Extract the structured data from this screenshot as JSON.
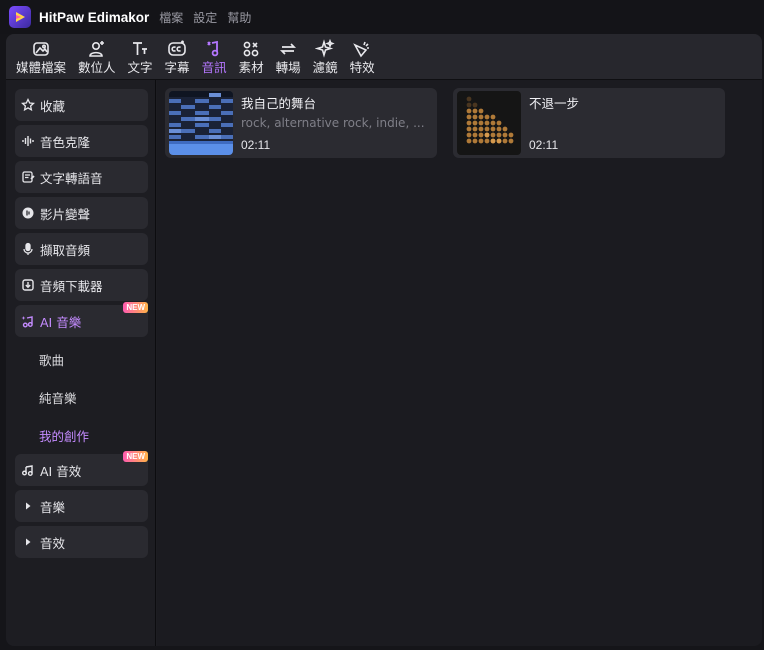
{
  "app": {
    "title": "HitPaw Edimakor",
    "menu": [
      "檔案",
      "設定",
      "幫助"
    ]
  },
  "toolbar": {
    "items": [
      {
        "label": "媒體檔案",
        "icon": "media-icon"
      },
      {
        "label": "數位人",
        "icon": "avatar-add-icon"
      },
      {
        "label": "文字",
        "icon": "text-icon"
      },
      {
        "label": "字幕",
        "icon": "subtitle-icon"
      },
      {
        "label": "音訊",
        "icon": "audio-icon",
        "active": true
      },
      {
        "label": "素材",
        "icon": "assets-icon"
      },
      {
        "label": "轉場",
        "icon": "transition-icon"
      },
      {
        "label": "濾鏡",
        "icon": "filter-icon"
      },
      {
        "label": "特效",
        "icon": "effects-icon"
      }
    ],
    "active_color": "#b577ff"
  },
  "sidebar": {
    "items": [
      {
        "label": "收藏",
        "icon": "star-icon"
      },
      {
        "label": "音色克隆",
        "icon": "waveform-icon"
      },
      {
        "label": "文字轉語音",
        "icon": "text-to-speech-icon"
      },
      {
        "label": "影片變聲",
        "icon": "voice-changer-icon"
      },
      {
        "label": "擷取音頻",
        "icon": "microphone-icon"
      },
      {
        "label": "音頻下載器",
        "icon": "download-icon"
      },
      {
        "label": "AI 音樂",
        "icon": "ai-music-icon",
        "badge": "NEW",
        "active": true
      },
      {
        "label": "AI 音效",
        "icon": "ai-sfx-icon",
        "badge": "NEW"
      },
      {
        "label": "音樂",
        "icon": "caret-right-icon"
      },
      {
        "label": "音效",
        "icon": "caret-right-icon"
      }
    ],
    "sub_items": [
      {
        "label": "歌曲"
      },
      {
        "label": "純音樂"
      },
      {
        "label": "我的創作",
        "active": true
      }
    ]
  },
  "tracks": [
    {
      "title": "我自己的舞台",
      "tags": "rock, alternative rock, indie, ...",
      "duration": "02:11"
    },
    {
      "title": "不退一步",
      "tags": "",
      "duration": "02:11"
    }
  ]
}
